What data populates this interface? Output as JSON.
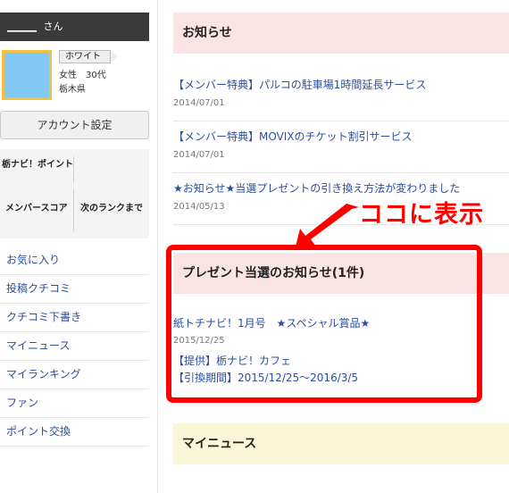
{
  "user": {
    "name": "______",
    "suffix": "さん",
    "rank": "ホワイト",
    "gender_age": "女性　30代",
    "prefecture": "栃木県"
  },
  "sidebar": {
    "account_settings": "アカウント設定",
    "stats": {
      "point_label": "栃ナビ！ポイント",
      "score_label": "メンバースコア",
      "next_rank_label": "次のランクまで"
    },
    "nav": [
      {
        "label": "お気に入り"
      },
      {
        "label": "投稿クチコミ"
      },
      {
        "label": "クチコミ下書き"
      },
      {
        "label": "マイニュース"
      },
      {
        "label": "マイランキング"
      },
      {
        "label": "ファン"
      },
      {
        "label": "ポイント交換"
      }
    ]
  },
  "notices": {
    "title": "お知らせ",
    "items": [
      {
        "title": "【メンバー特典】パルコの駐車場1時間延長サービス",
        "date": "2014/07/01"
      },
      {
        "title": "【メンバー特典】MOVIXのチケット割引サービス",
        "date": "2014/07/01"
      },
      {
        "title": "★お知らせ★当選プレゼントの引き換え方法が変わりました",
        "date": "2014/05/13"
      }
    ]
  },
  "present": {
    "title": "プレゼント当選のお知らせ(1件)",
    "item_title": "紙トチナビ！1月号　★スペシャル賞品★",
    "date": "2015/12/25",
    "provider": "【提供】栃ナビ！カフェ",
    "period": "【引換期間】2015/12/25～2016/3/5"
  },
  "mynews": {
    "title": "マイニュース"
  },
  "annotation": {
    "label": "ココに表示",
    "color": "#ff0000"
  },
  "colors": {
    "notice_header_bg": "#fae3e3",
    "mynews_header_bg": "#fcf6d8",
    "link": "#2a4ea0",
    "user_bar": "#3a3a3a",
    "avatar": "#82c8f5"
  }
}
